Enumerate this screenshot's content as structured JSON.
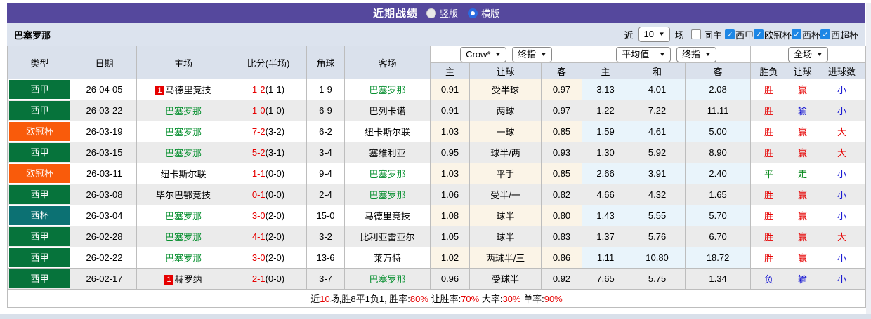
{
  "colors": {
    "header_purple": "#55489D",
    "filter_bar_bg": "#DCE3EE",
    "table_header_bg": "#DAE1EC",
    "crow_group_bg": "#FBF4E7",
    "avg_group_bg": "#E9F4FB",
    "red": "#E60000",
    "blue": "#1212D2",
    "green": "#0A8A1E",
    "team_green": "#089030",
    "league": {
      "西甲": "#06733B",
      "欧冠杯": "#F95B0B",
      "西杯": "#0C7173"
    }
  },
  "title_bar": {
    "title": "近期战绩",
    "radios": [
      {
        "label": "竖版",
        "checked": false
      },
      {
        "label": "横版",
        "checked": true
      }
    ]
  },
  "filter_bar": {
    "team": "巴塞罗那",
    "recent_label": "近",
    "recent_value": "10",
    "games_label": "场",
    "same_home": {
      "label": "同主",
      "checked": false
    },
    "leagues": [
      {
        "label": "西甲",
        "checked": true
      },
      {
        "label": "欧冠杯",
        "checked": true
      },
      {
        "label": "西杯",
        "checked": true
      },
      {
        "label": "西超杯",
        "checked": true
      }
    ]
  },
  "odds_selectors": {
    "crow": "Crow*",
    "crow_stage": "终指",
    "avg": "平均值",
    "avg_stage": "终指",
    "scope": "全场"
  },
  "table": {
    "headers": {
      "type": "类型",
      "date": "日期",
      "home": "主场",
      "score": "比分(半场)",
      "corner": "角球",
      "away": "客场",
      "g1": [
        "主",
        "让球",
        "客"
      ],
      "g2": [
        "主",
        "和",
        "客"
      ],
      "g3": [
        "胜负",
        "让球",
        "进球数"
      ]
    },
    "rows": [
      {
        "type": "西甲",
        "date": "26-04-05",
        "home": {
          "badge": "1",
          "name": "马德里竞技",
          "green": false
        },
        "score": "1-2",
        "half": "(1-1)",
        "corner": "1-9",
        "away": {
          "name": "巴塞罗那",
          "green": true
        },
        "crow": [
          "0.91",
          "受半球",
          "0.97"
        ],
        "avg": [
          "3.13",
          "4.01",
          "2.08"
        ],
        "res": [
          [
            "胜",
            "red"
          ],
          [
            "赢",
            "red"
          ],
          [
            "小",
            "blue"
          ]
        ]
      },
      {
        "type": "西甲",
        "date": "26-03-22",
        "home": {
          "badge": "",
          "name": "巴塞罗那",
          "green": true
        },
        "score": "1-0",
        "half": "(1-0)",
        "corner": "6-9",
        "away": {
          "name": "巴列卡诺",
          "green": false
        },
        "crow": [
          "0.91",
          "两球",
          "0.97"
        ],
        "avg": [
          "1.22",
          "7.22",
          "11.11"
        ],
        "res": [
          [
            "胜",
            "red"
          ],
          [
            "输",
            "blue"
          ],
          [
            "小",
            "blue"
          ]
        ]
      },
      {
        "type": "欧冠杯",
        "date": "26-03-19",
        "home": {
          "badge": "",
          "name": "巴塞罗那",
          "green": true
        },
        "score": "7-2",
        "half": "(3-2)",
        "corner": "6-2",
        "away": {
          "name": "纽卡斯尔联",
          "green": false
        },
        "crow": [
          "1.03",
          "一球",
          "0.85"
        ],
        "avg": [
          "1.59",
          "4.61",
          "5.00"
        ],
        "res": [
          [
            "胜",
            "red"
          ],
          [
            "赢",
            "red"
          ],
          [
            "大",
            "red"
          ]
        ]
      },
      {
        "type": "西甲",
        "date": "26-03-15",
        "home": {
          "badge": "",
          "name": "巴塞罗那",
          "green": true
        },
        "score": "5-2",
        "half": "(3-1)",
        "corner": "3-4",
        "away": {
          "name": "塞维利亚",
          "green": false
        },
        "crow": [
          "0.95",
          "球半/两",
          "0.93"
        ],
        "avg": [
          "1.30",
          "5.92",
          "8.90"
        ],
        "res": [
          [
            "胜",
            "red"
          ],
          [
            "赢",
            "red"
          ],
          [
            "大",
            "red"
          ]
        ]
      },
      {
        "type": "欧冠杯",
        "date": "26-03-11",
        "home": {
          "badge": "",
          "name": "纽卡斯尔联",
          "green": false
        },
        "score": "1-1",
        "half": "(0-0)",
        "corner": "9-4",
        "away": {
          "name": "巴塞罗那",
          "green": true
        },
        "crow": [
          "1.03",
          "平手",
          "0.85"
        ],
        "avg": [
          "2.66",
          "3.91",
          "2.40"
        ],
        "res": [
          [
            "平",
            "green"
          ],
          [
            "走",
            "green"
          ],
          [
            "小",
            "blue"
          ]
        ]
      },
      {
        "type": "西甲",
        "date": "26-03-08",
        "home": {
          "badge": "",
          "name": "毕尔巴鄂竞技",
          "green": false
        },
        "score": "0-1",
        "half": "(0-0)",
        "corner": "2-4",
        "away": {
          "name": "巴塞罗那",
          "green": true
        },
        "crow": [
          "1.06",
          "受半/一",
          "0.82"
        ],
        "avg": [
          "4.66",
          "4.32",
          "1.65"
        ],
        "res": [
          [
            "胜",
            "red"
          ],
          [
            "赢",
            "red"
          ],
          [
            "小",
            "blue"
          ]
        ]
      },
      {
        "type": "西杯",
        "date": "26-03-04",
        "home": {
          "badge": "",
          "name": "巴塞罗那",
          "green": true
        },
        "score": "3-0",
        "half": "(2-0)",
        "corner": "15-0",
        "away": {
          "name": "马德里竞技",
          "green": false
        },
        "crow": [
          "1.08",
          "球半",
          "0.80"
        ],
        "avg": [
          "1.43",
          "5.55",
          "5.70"
        ],
        "res": [
          [
            "胜",
            "red"
          ],
          [
            "赢",
            "red"
          ],
          [
            "小",
            "blue"
          ]
        ]
      },
      {
        "type": "西甲",
        "date": "26-02-28",
        "home": {
          "badge": "",
          "name": "巴塞罗那",
          "green": true
        },
        "score": "4-1",
        "half": "(2-0)",
        "corner": "3-2",
        "away": {
          "name": "比利亚雷亚尔",
          "green": false
        },
        "crow": [
          "1.05",
          "球半",
          "0.83"
        ],
        "avg": [
          "1.37",
          "5.76",
          "6.70"
        ],
        "res": [
          [
            "胜",
            "red"
          ],
          [
            "赢",
            "red"
          ],
          [
            "大",
            "red"
          ]
        ]
      },
      {
        "type": "西甲",
        "date": "26-02-22",
        "home": {
          "badge": "",
          "name": "巴塞罗那",
          "green": true
        },
        "score": "3-0",
        "half": "(2-0)",
        "corner": "13-6",
        "away": {
          "name": "莱万特",
          "green": false
        },
        "crow": [
          "1.02",
          "两球半/三",
          "0.86"
        ],
        "avg": [
          "1.11",
          "10.80",
          "18.72"
        ],
        "res": [
          [
            "胜",
            "red"
          ],
          [
            "赢",
            "red"
          ],
          [
            "小",
            "blue"
          ]
        ]
      },
      {
        "type": "西甲",
        "date": "26-02-17",
        "home": {
          "badge": "1",
          "name": "赫罗纳",
          "green": false
        },
        "score": "2-1",
        "half": "(0-0)",
        "corner": "3-7",
        "away": {
          "name": "巴塞罗那",
          "green": true
        },
        "crow": [
          "0.96",
          "受球半",
          "0.92"
        ],
        "avg": [
          "7.65",
          "5.75",
          "1.34"
        ],
        "res": [
          [
            "负",
            "blue"
          ],
          [
            "输",
            "blue"
          ],
          [
            "小",
            "blue"
          ]
        ]
      }
    ]
  },
  "summary": {
    "segments": [
      [
        "近",
        "black"
      ],
      [
        "10",
        "red"
      ],
      [
        "场,胜8平1负1, ",
        "black"
      ],
      [
        "胜率:",
        "black"
      ],
      [
        "80%",
        "red"
      ],
      [
        " 让胜率:",
        "black"
      ],
      [
        "70%",
        "red"
      ],
      [
        " 大率:",
        "black"
      ],
      [
        "30%",
        "red"
      ],
      [
        " 单率:",
        "black"
      ],
      [
        "90%",
        "red"
      ]
    ]
  }
}
